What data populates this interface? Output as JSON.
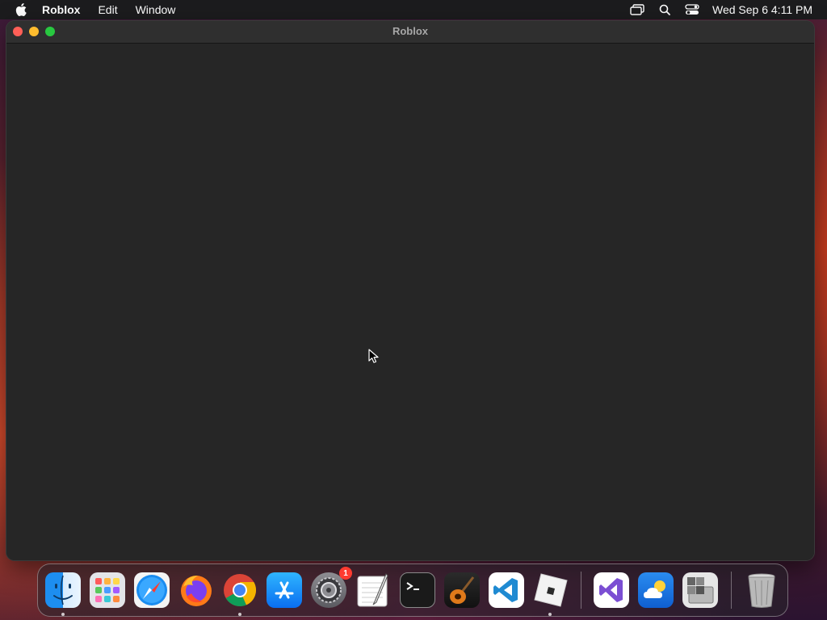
{
  "menubar": {
    "app_name": "Roblox",
    "items": [
      "Edit",
      "Window"
    ],
    "clock": "Wed Sep 6  4:11 PM"
  },
  "window": {
    "title": "Roblox"
  },
  "dock": {
    "apps": [
      {
        "name": "Finder",
        "running": true
      },
      {
        "name": "Launchpad",
        "running": false
      },
      {
        "name": "Safari",
        "running": false
      },
      {
        "name": "Firefox",
        "running": false
      },
      {
        "name": "Google Chrome",
        "running": true
      },
      {
        "name": "App Store",
        "running": false
      },
      {
        "name": "System Settings",
        "running": false,
        "badge": "1"
      },
      {
        "name": "TextEdit",
        "running": false
      },
      {
        "name": "Terminal",
        "running": false
      },
      {
        "name": "GarageBand",
        "running": false
      },
      {
        "name": "Visual Studio Code",
        "running": false
      },
      {
        "name": "Roblox",
        "running": true
      }
    ],
    "others": [
      {
        "name": "Visual Studio"
      },
      {
        "name": "Weather"
      },
      {
        "name": "Boot Camp Assistant"
      },
      {
        "name": "Trash"
      }
    ]
  }
}
